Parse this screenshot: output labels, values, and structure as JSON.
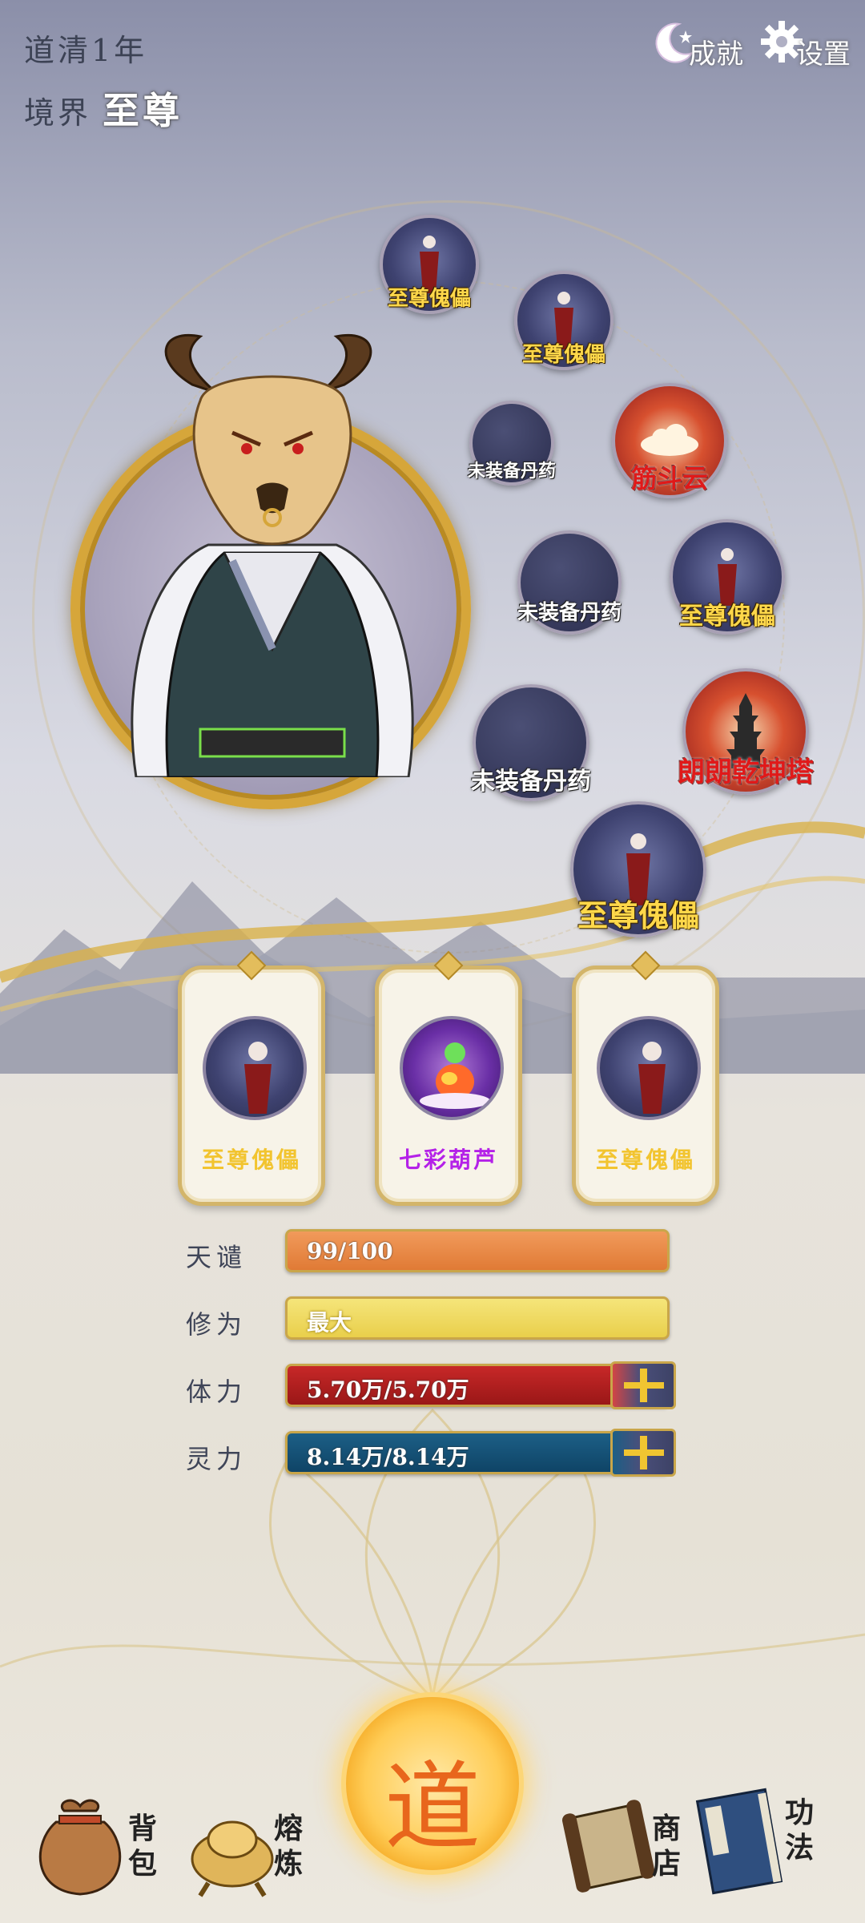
{
  "header": {
    "year": "道清1年",
    "realm_prefix": "境界",
    "realm_value": "至尊"
  },
  "top_buttons": {
    "achievement": "成就",
    "settings": "设置"
  },
  "slots": [
    {
      "label": "至尊傀儡",
      "kind": "puppet"
    },
    {
      "label": "至尊傀儡",
      "kind": "puppet"
    },
    {
      "label": "未装备丹药",
      "kind": "empty"
    },
    {
      "label": "筋斗云",
      "kind": "cloud"
    },
    {
      "label": "未装备丹药",
      "kind": "empty"
    },
    {
      "label": "至尊傀儡",
      "kind": "puppet"
    },
    {
      "label": "未装备丹药",
      "kind": "empty"
    },
    {
      "label": "朗朗乾坤塔",
      "kind": "tower"
    },
    {
      "label": "至尊傀儡",
      "kind": "puppet"
    }
  ],
  "cards": [
    {
      "name": "至尊傀儡",
      "kind": "puppet"
    },
    {
      "name": "七彩葫芦",
      "kind": "gourd"
    },
    {
      "name": "至尊傀儡",
      "kind": "puppet"
    }
  ],
  "stats": {
    "tianqian": {
      "label": "天谴",
      "value": "99/100",
      "progress": 0.99
    },
    "xiuwei": {
      "label": "修为",
      "value": "最大",
      "progress": 1.0
    },
    "tili": {
      "label": "体力",
      "value": "5.70万/5.70万",
      "progress": 1.0
    },
    "lingli": {
      "label": "灵力",
      "value": "8.14万/8.14万",
      "progress": 1.0
    }
  },
  "nav": {
    "bag": "背包",
    "smelt": "熔炼",
    "dao": "道",
    "shop": "商店",
    "skills": "功法"
  },
  "colors": {
    "gold": "#d6a63a",
    "orange_bar": "#e07a35",
    "yellow_bar": "#e9cf4b",
    "red_bar": "#9a1717",
    "blue_bar": "#0f4466"
  }
}
